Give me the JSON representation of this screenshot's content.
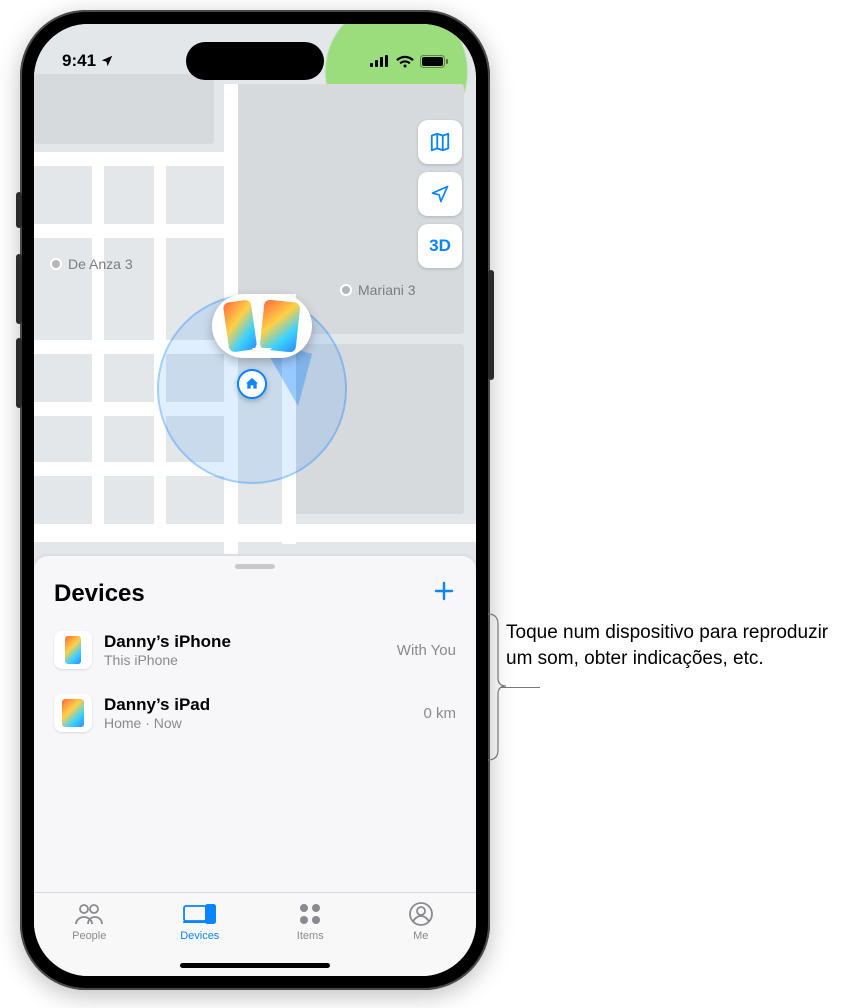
{
  "statusbar": {
    "time": "9:41"
  },
  "map": {
    "pois": [
      {
        "label": "De Anza 3"
      },
      {
        "label": "Mariani 3"
      }
    ],
    "controls": {
      "threeD": "3D"
    }
  },
  "sheet": {
    "title": "Devices",
    "devices": [
      {
        "name": "Danny’s iPhone",
        "subtitle": "This iPhone",
        "meta": "With You"
      },
      {
        "name": "Danny’s iPad",
        "subtitle": "Home · Now",
        "meta": "0 km"
      }
    ]
  },
  "tabs": {
    "people": "People",
    "devices": "Devices",
    "items": "Items",
    "me": "Me"
  },
  "callout": {
    "text": "Toque num dispositivo para reproduzir um som, obter indicações, etc."
  }
}
